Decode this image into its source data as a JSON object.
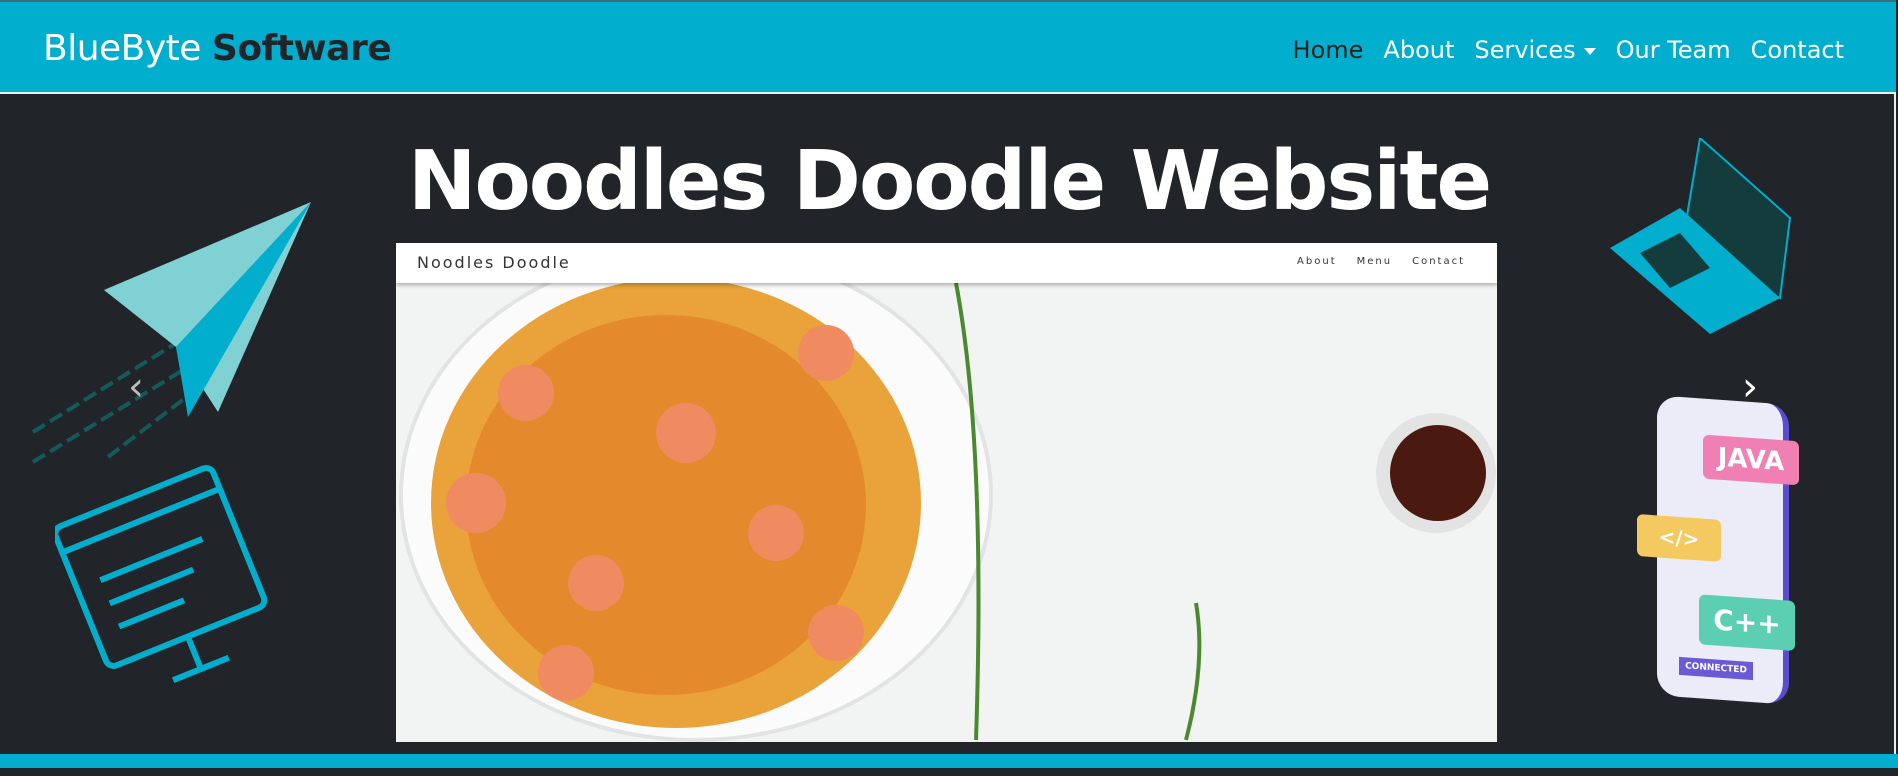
{
  "navbar": {
    "brand_light": "BlueByte",
    "brand_bold": "Software",
    "links": [
      {
        "label": "Home",
        "active": true
      },
      {
        "label": "About"
      },
      {
        "label": "Services",
        "dropdown": true
      },
      {
        "label": "Our Team"
      },
      {
        "label": "Contact"
      }
    ]
  },
  "carousel": {
    "slide_title": "Noodles Doodle Website",
    "mockup": {
      "brand": "Noodles Doodle",
      "links": [
        "About",
        "Menu",
        "Contact"
      ]
    },
    "prev_icon": "chevron-left-icon",
    "next_icon": "chevron-right-icon"
  },
  "decorations": {
    "badges": [
      "JAVA",
      "</>",
      "C++",
      "CONNECTED"
    ]
  },
  "colors": {
    "accent": "#02aecd",
    "dark": "#212529"
  }
}
